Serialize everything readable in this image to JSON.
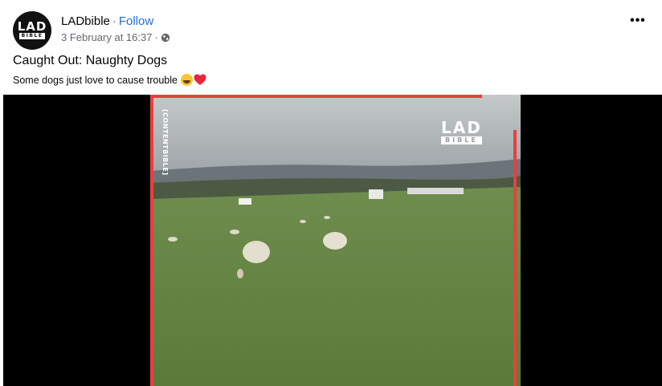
{
  "post": {
    "page_name": "LADbible",
    "separator": "·",
    "follow_label": "Follow",
    "timestamp": "3 February at 16:37",
    "time_separator": "·",
    "audience_icon": "globe-icon",
    "more_label": "•••",
    "title": "Caught Out: Naughty Dogs",
    "caption": "Some dogs just love to cause trouble",
    "caption_emojis": [
      "laughing-face-emoji",
      "red-heart-emoji"
    ]
  },
  "avatar": {
    "line1": "LAD",
    "line2": "BIBLE"
  },
  "video": {
    "watermark_line1": "LAD",
    "watermark_line2": "BIBLE",
    "credit": "[CONTENTBIBLE]",
    "accent_color": "#e8403d"
  },
  "colors": {
    "link_blue": "#216fdb",
    "secondary_text": "#65676b",
    "primary_text": "#050505"
  }
}
